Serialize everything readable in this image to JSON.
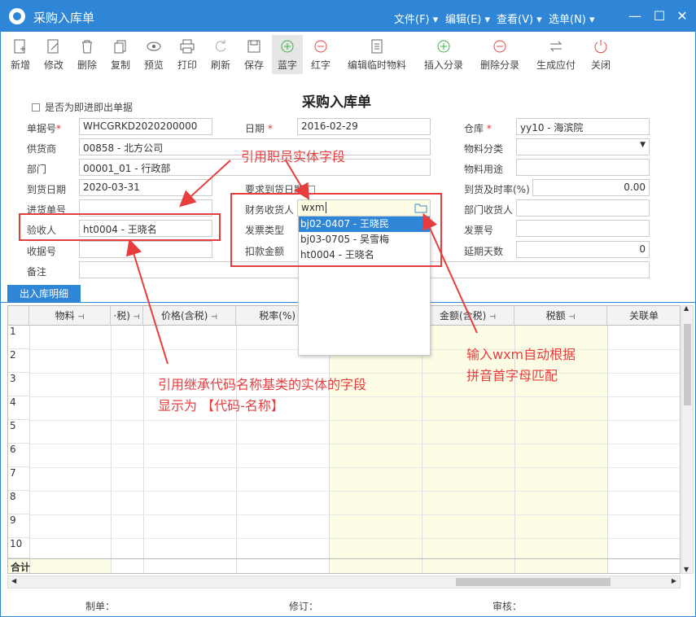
{
  "window": {
    "title": "采购入库单",
    "menus": [
      "文件(F)",
      "编辑(E)",
      "查看(V)",
      "选单(N)"
    ]
  },
  "toolbar": [
    "新增",
    "修改",
    "删除",
    "复制",
    "预览",
    "打印",
    "刷新",
    "保存",
    "蓝字",
    "红字",
    "编辑临时物料",
    "插入分录",
    "删除分录",
    "生成应付",
    "关闭"
  ],
  "form": {
    "title": "采购入库单",
    "instant_checkbox_label": "是否为即进即出单据",
    "labels": {
      "doc_no": "单据号",
      "date": "日期",
      "warehouse": "仓库",
      "supplier": "供货商",
      "material_category": "物料分类",
      "dept": "部门",
      "material_use": "物料用途",
      "arrival_date": "到货日期",
      "require_arrival_date": "要求到货日期",
      "ontime_rate": "到货及时率(%)",
      "purchase_order_no": "进货单号",
      "finance_receiver": "财务收货人",
      "dept_receiver": "部门收货人",
      "inspector": "验收人",
      "invoice_type": "发票类型",
      "invoice_no": "发票号",
      "receipt_no": "收据号",
      "deduction": "扣款金额",
      "delay_days": "延期天数",
      "remark": "备注"
    },
    "values": {
      "doc_no": "WHCGRKD2020200000",
      "date": "2016-02-29",
      "warehouse": "yy10 - 海滨院",
      "supplier": "00858 - 北方公司",
      "dept": "00001_01 - 行政部",
      "arrival_date": "2020-03-31",
      "ontime_rate": "0.00",
      "inspector": "ht0004 - 王晓名",
      "finance_receiver": "wxm",
      "delay_days": "0"
    }
  },
  "dropdown": {
    "items": [
      "bj02-0407 - 王晓民",
      "bj03-0705 - 吴雪梅",
      "ht0004 - 王晓名"
    ],
    "selected_index": 0
  },
  "annotations": {
    "employee_field": "引用职员实体字段",
    "pinyin_match_line1": "输入wxm自动根据",
    "pinyin_match_line2": "拼音首字母匹配",
    "code_name_line1": "引用继承代码名称基类的实体的字段",
    "code_name_line2": "显示为 【代码-名称】"
  },
  "detail": {
    "tab": "出入库明细",
    "columns": [
      "物料",
      "·税)",
      "价格(含税)",
      "税率(%)",
      "金额(含税)",
      "税额",
      "关联单"
    ],
    "rows": [
      "1",
      "2",
      "3",
      "4",
      "5",
      "6",
      "7",
      "8",
      "9",
      "10"
    ],
    "total_label": "合计"
  },
  "status": {
    "maker": "制单：",
    "revise": "修订：",
    "audit": "审核："
  },
  "colors": {
    "accent": "#2f86d6",
    "annotation": "#e83d3d"
  }
}
